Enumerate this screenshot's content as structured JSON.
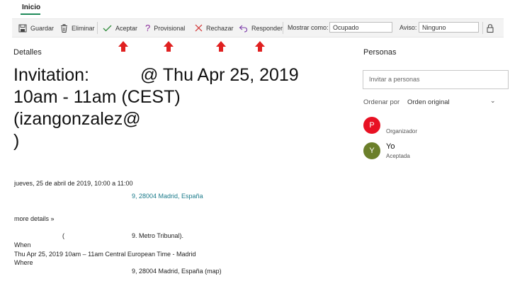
{
  "tabs": {
    "inicio": "Inicio"
  },
  "toolbar": {
    "save": "Guardar",
    "delete": "Eliminar",
    "accept": "Aceptar",
    "tentative": "Provisional",
    "decline": "Rechazar",
    "reply": "Responder",
    "show_as_label": "Mostrar como:",
    "show_as_value": "Ocupado",
    "reminder_label": "Aviso:",
    "reminder_value": "Ninguno"
  },
  "details": {
    "heading": "Detalles",
    "subject_line1_a": "Invitation:",
    "subject_line1_b": "@ Thu Apr 25, 2019",
    "subject_line2": "10am - 11am (CEST)",
    "subject_line3": "(izangonzalez@",
    "subject_line4": ")",
    "when": "jueves, 25 de abril de 2019, 10:00 a 11:00",
    "location": "9, 28004 Madrid, España",
    "more_details": "more details »",
    "body_paren": "(",
    "body_metro": "9. Metro Tribunal).",
    "body_when_label": "When",
    "body_when_value": "Thu Apr 25, 2019 10am – 11am Central European Time - Madrid",
    "body_where_label": "Where",
    "body_where_value": "9, 28004 Madrid, España (map)"
  },
  "people": {
    "heading": "Personas",
    "invite_placeholder": "Invitar a personas",
    "sort_label": "Ordenar por",
    "sort_value": "Orden original",
    "list": [
      {
        "initial": "P",
        "name": "",
        "role": "Organizador",
        "color": "#e81123"
      },
      {
        "initial": "Y",
        "name": "Yo",
        "role": "Aceptada",
        "color": "#6b7f2a"
      }
    ]
  },
  "colors": {
    "accent": "#1f8a5a",
    "arrow": "#e02020",
    "link": "#1a7a8a"
  }
}
